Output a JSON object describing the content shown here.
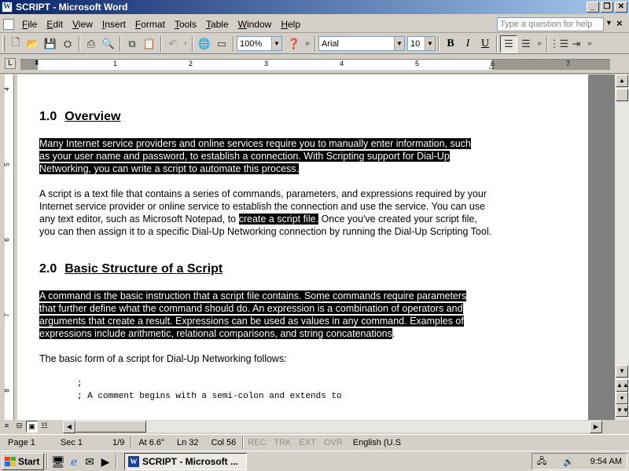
{
  "window": {
    "title": "SCRIPT - Microsoft Word",
    "app_icon_letter": "W"
  },
  "menu": {
    "items": [
      "File",
      "Edit",
      "View",
      "Insert",
      "Format",
      "Tools",
      "Table",
      "Window",
      "Help"
    ],
    "help_placeholder": "Type a question for help"
  },
  "toolbar": {
    "zoom": "100%",
    "font": "Arial",
    "font_size": "10",
    "bold": "B",
    "italic": "I",
    "underline": "U"
  },
  "ruler": {
    "numbers": [
      "1",
      "2",
      "3",
      "4",
      "5",
      "6",
      "7"
    ],
    "vnumbers": [
      "4",
      "5",
      "6",
      "7",
      "8"
    ]
  },
  "document": {
    "h1_num": "1.0",
    "h1_title": "Overview",
    "p1_l1": "Many Internet service providers and online services require you to manually enter information, such",
    "p1_l2": "as your user name and password, to establish a connection. With Scripting support for Dial-Up",
    "p1_l3": "Networking, you can write a script to automate this process.",
    "p2_a": "A script is a text file that contains a series of commands, parameters, and expressions required by your Internet service provider or online service to establish the connection and use the service. You can use any text editor, such as Microsoft Notepad, to ",
    "p2_sel": "create a script file.",
    "p2_b": " Once you've created your script file, you can then assign it to a specific Dial-Up Networking connection by running the Dial-Up Scripting Tool.",
    "h2_num": "2.0",
    "h2_title": "Basic Structure of a Script",
    "p3_l1": "A command is the basic instruction that a script file contains. Some commands require parameters",
    "p3_l2": "that further define what the command should do. An expression is a combination of operators and",
    "p3_l3": "arguments that create a result. Expressions can be used as values in any command.  Examples of",
    "p3_l4": "expressions include arithmetic, relational comparisons, and string concatenations",
    "p3_end": ".",
    "p4": "The basic form of a script for Dial-Up Networking follows:",
    "code1": ";",
    "code2": "; A comment begins with a semi-colon and extends to"
  },
  "status": {
    "page": "Page 1",
    "sec": "Sec 1",
    "pages": "1/9",
    "at": "At 6.6\"",
    "ln": "Ln 32",
    "col": "Col 56",
    "rec": "REC",
    "trk": "TRK",
    "ext": "EXT",
    "ovr": "OVR",
    "lang": "English (U.S"
  },
  "taskbar": {
    "start": "Start",
    "task": "SCRIPT - Microsoft ...",
    "clock": "9:54 AM"
  }
}
